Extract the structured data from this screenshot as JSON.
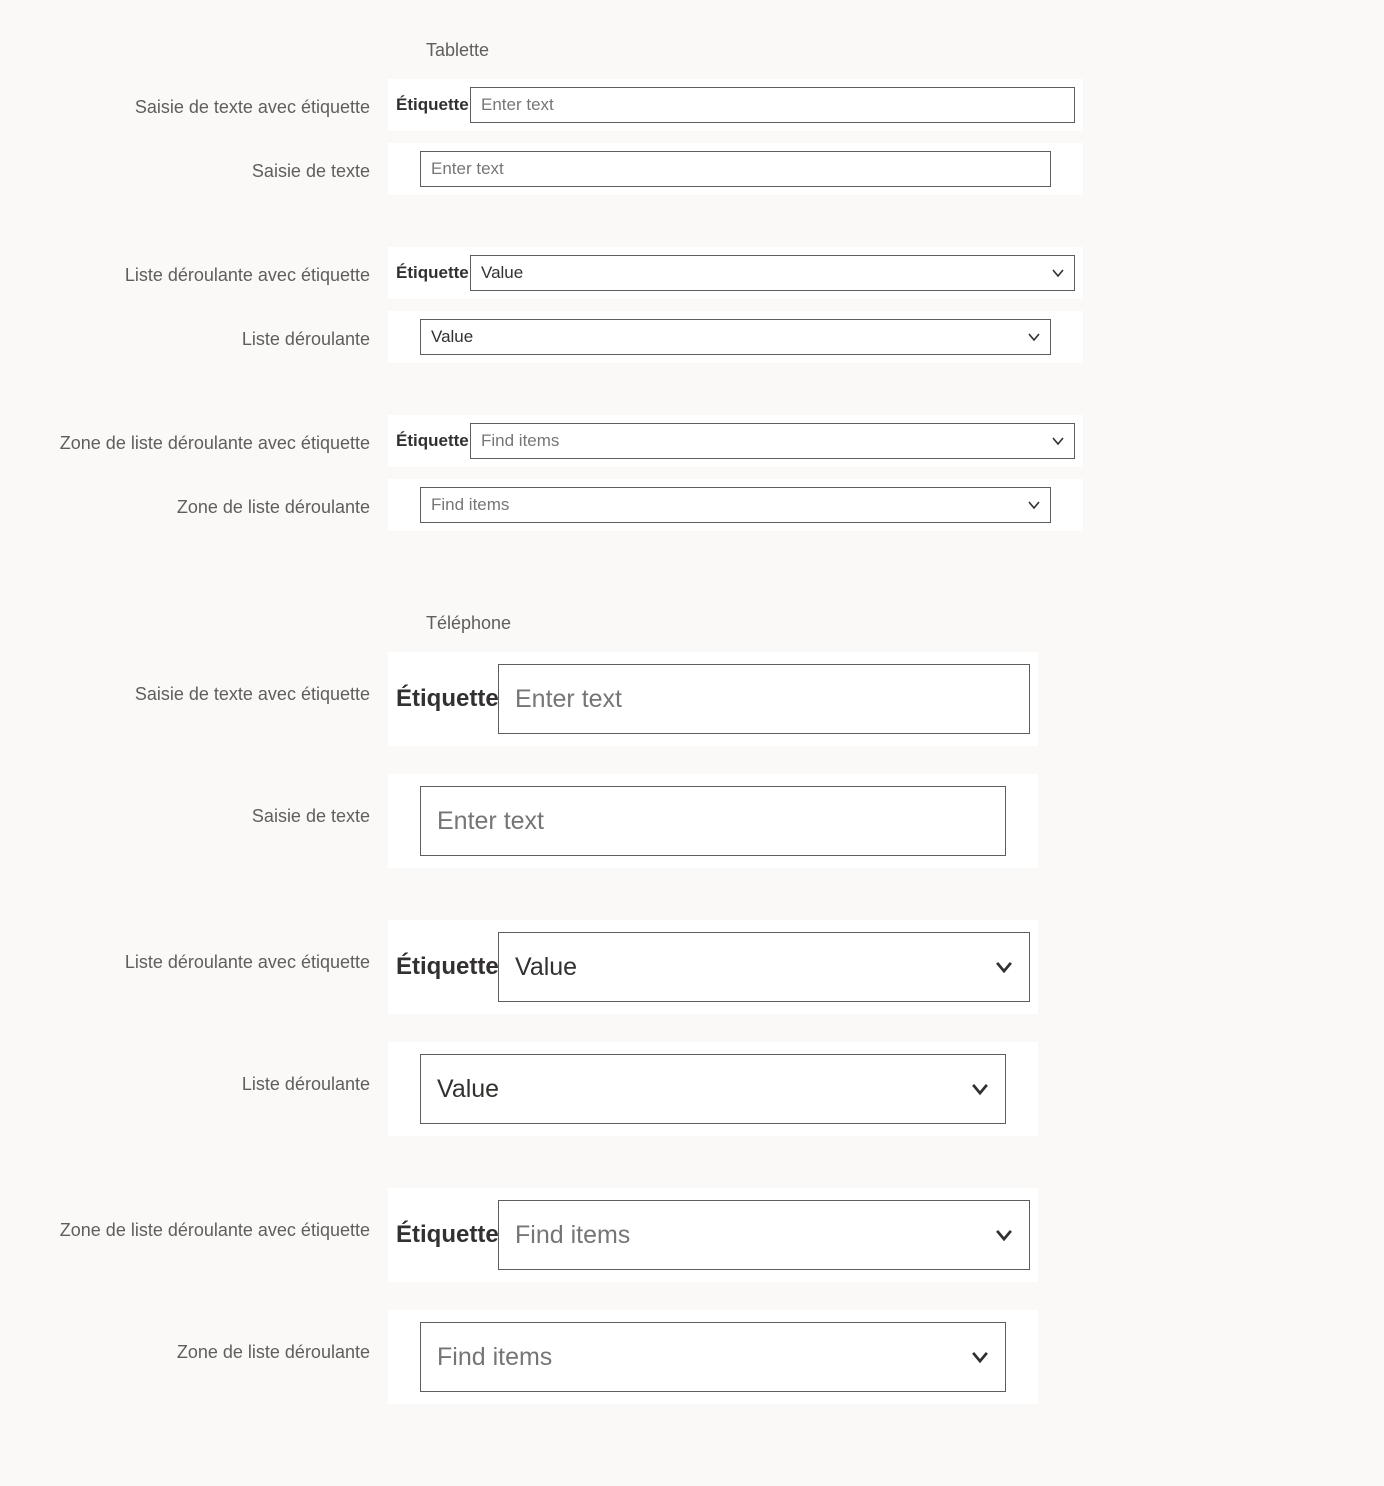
{
  "sections": {
    "tablet": {
      "heading": "Tablette",
      "rows": {
        "text_with_label": {
          "legend": "Saisie de texte avec étiquette",
          "label": "Étiquette",
          "placeholder": "Enter text"
        },
        "text_no_label": {
          "legend": "Saisie de texte",
          "placeholder": "Enter text"
        },
        "dropdown_with_label": {
          "legend": "Liste déroulante avec étiquette",
          "label": "Étiquette",
          "value": "Value"
        },
        "dropdown_no_label": {
          "legend": "Liste déroulante",
          "value": "Value"
        },
        "combo_with_label": {
          "legend": "Zone de liste déroulante avec étiquette",
          "label": "Étiquette",
          "placeholder": "Find items"
        },
        "combo_no_label": {
          "legend": "Zone de liste déroulante",
          "placeholder": "Find items"
        }
      }
    },
    "phone": {
      "heading": "Téléphone",
      "rows": {
        "text_with_label": {
          "legend": "Saisie de texte avec étiquette",
          "label": "Étiquette",
          "placeholder": "Enter text"
        },
        "text_no_label": {
          "legend": "Saisie de texte",
          "placeholder": "Enter text"
        },
        "dropdown_with_label": {
          "legend": "Liste déroulante avec étiquette",
          "label": "Étiquette",
          "value": "Value"
        },
        "dropdown_no_label": {
          "legend": "Liste déroulante",
          "value": "Value"
        },
        "combo_with_label": {
          "legend": "Zone de liste déroulante avec étiquette",
          "label": "Étiquette",
          "placeholder": "Find items"
        },
        "combo_no_label": {
          "legend": "Zone de liste déroulante",
          "placeholder": "Find items"
        }
      }
    }
  }
}
